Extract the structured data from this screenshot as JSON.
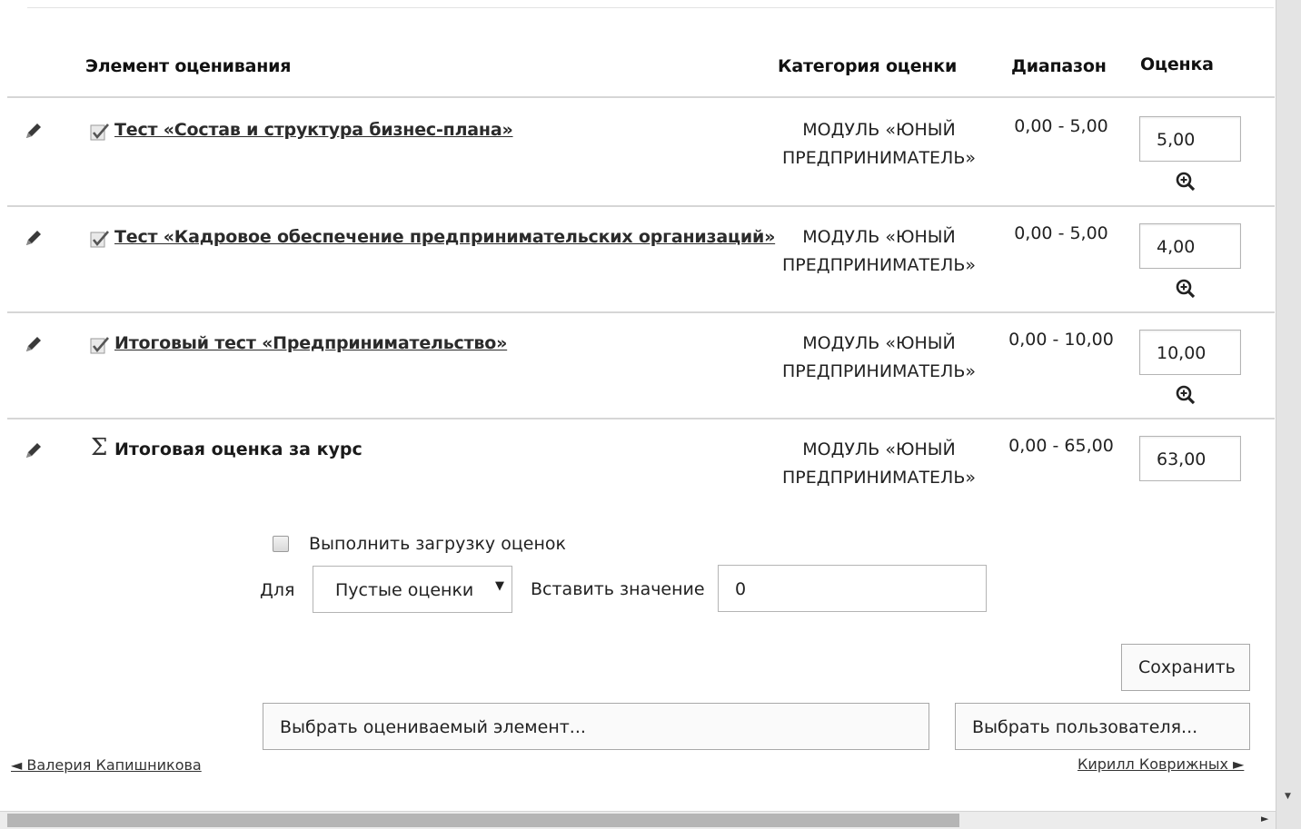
{
  "headers": {
    "item": "Элемент оценивания",
    "category": "Категория оценки",
    "range": "Диапазон",
    "grade": "Оценка"
  },
  "rows": [
    {
      "name": "Тест «Состав и структура бизнес-плана»",
      "category": "МОДУЛЬ «ЮНЫЙ ПРЕДПРИНИМАТЕЛЬ»",
      "range": "0,00 - 5,00",
      "grade": "5,00",
      "icon": "quiz-icon"
    },
    {
      "name": "Тест «Кадровое обеспечение предпринимательских организаций»",
      "category": "МОДУЛЬ «ЮНЫЙ ПРЕДПРИНИМАТЕЛЬ»",
      "range": "0,00 - 5,00",
      "grade": "4,00",
      "icon": "quiz-icon"
    },
    {
      "name": "Итоговый тест «Предпринимательство»",
      "category": "МОДУЛЬ «ЮНЫЙ ПРЕДПРИНИМАТЕЛЬ»",
      "range": "0,00 - 10,00",
      "grade": "10,00",
      "icon": "quiz-icon"
    },
    {
      "name": "Итоговая оценка за курс",
      "category": "МОДУЛЬ «ЮНЫЙ ПРЕДПРИНИМАТЕЛЬ»",
      "range": "0,00 - 65,00",
      "grade": "63,00",
      "icon": "sigma-icon"
    }
  ],
  "bulk": {
    "checkbox_label": "Выполнить загрузку оценок",
    "for_label": "Для",
    "select_value": "Пустые оценки",
    "insert_label": "Вставить значение",
    "insert_value": "0"
  },
  "buttons": {
    "save": "Сохранить",
    "select_item": "Выбрать оцениваемый элемент...",
    "select_user": "Выбрать пользователя..."
  },
  "nav": {
    "prev_user": "◄ Валерия Капишникова",
    "next_user": "Кирилл Коврижных ►"
  }
}
